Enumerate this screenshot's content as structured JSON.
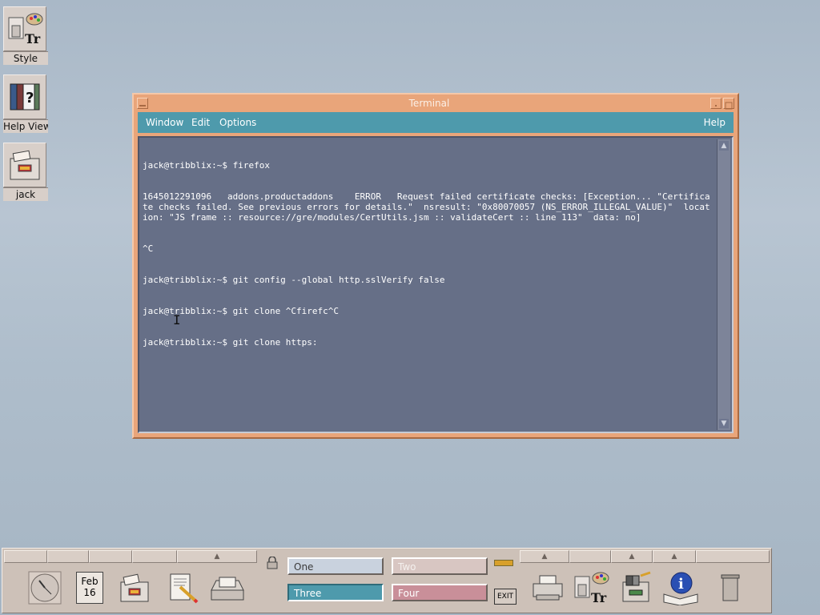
{
  "desktop_icons": [
    {
      "label": "Style",
      "icon": "style-manager-icon"
    },
    {
      "label": "Help View",
      "icon": "help-viewer-icon"
    },
    {
      "label": "jack",
      "icon": "home-folder-icon"
    }
  ],
  "window": {
    "title": "Terminal",
    "menus": [
      "Window",
      "Edit",
      "Options"
    ],
    "help_menu": "Help",
    "terminal_lines": [
      "jack@tribblix:~$ firefox",
      "1645012291096\taddons.productaddons\tERROR\tRequest failed certificate checks: [Exception... \"Certificate checks failed. See previous errors for details.\"  nsresult: \"0x80070057 (NS_ERROR_ILLEGAL_VALUE)\"  location: \"JS frame :: resource://gre/modules/CertUtils.jsm :: validateCert :: line 113\"  data: no]",
      "^C",
      "jack@tribblix:~$ git config --global http.sslVerify false",
      "jack@tribblix:~$ git clone ^Cfirefc^C",
      "jack@tribblix:~$ git clone https:"
    ]
  },
  "panel": {
    "calendar_month": "Feb",
    "calendar_day": "16",
    "workspaces": [
      {
        "label": "One",
        "color": "#c9d2de",
        "text_color": "#3b3b3b"
      },
      {
        "label": "Two",
        "color": "#d8c6c2",
        "text_color": "#f4f0ee"
      },
      {
        "label": "Three",
        "color": "#4e9aac",
        "text_color": "#ffffff"
      },
      {
        "label": "Four",
        "color": "#c98f99",
        "text_color": "#ffffff"
      }
    ],
    "exit_label": "EXIT"
  },
  "colors": {
    "window_frame": "#e9a57a",
    "menubar": "#4e9aac",
    "terminal_bg": "#666f87",
    "panel_bg": "#cdc1b8"
  }
}
